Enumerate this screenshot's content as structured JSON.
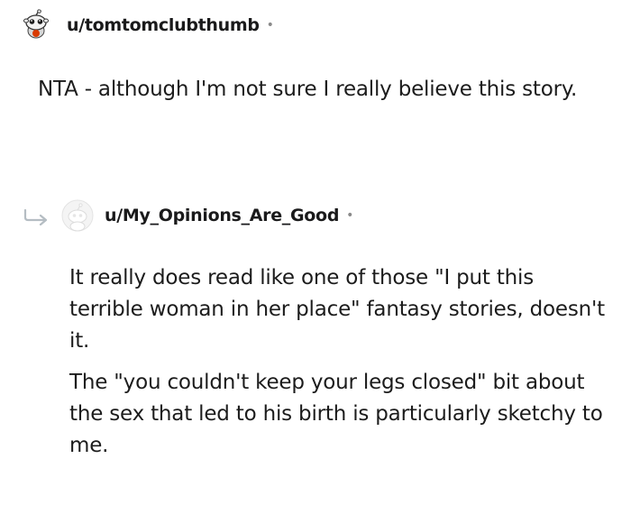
{
  "comments": [
    {
      "username": "u/tomtomclubthumb",
      "separator": "•",
      "paragraphs": [
        "NTA - although I'm not sure I really believe this story."
      ]
    },
    {
      "username": "u/My_Opinions_Are_Good",
      "separator": "•",
      "is_reply": true,
      "paragraphs": [
        "It really does read like one of those \"I put this terrible woman in her place\" fantasy stories, doesn't it.",
        "The \"you couldn't keep your legs closed\" bit about the sex that led to his birth is particularly sketchy to me."
      ]
    }
  ],
  "icons": {
    "avatar_1": "reddit-snoo-avatar-icon",
    "avatar_2": "default-avatar-icon",
    "reply": "reply-arrow-icon"
  }
}
